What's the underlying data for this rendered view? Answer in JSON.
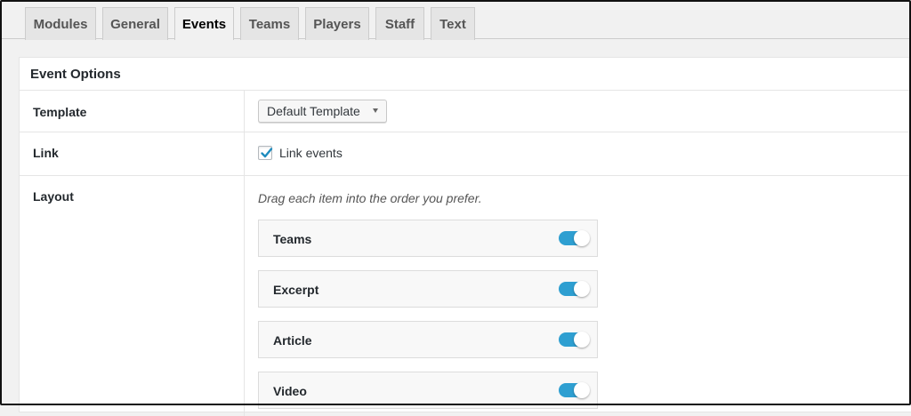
{
  "tabs": [
    {
      "label": "Modules",
      "active": false
    },
    {
      "label": "General",
      "active": false
    },
    {
      "label": "Events",
      "active": true
    },
    {
      "label": "Teams",
      "active": false
    },
    {
      "label": "Players",
      "active": false
    },
    {
      "label": "Staff",
      "active": false
    },
    {
      "label": "Text",
      "active": false
    }
  ],
  "panel": {
    "title": "Event Options",
    "template": {
      "label": "Template",
      "selected": "Default Template"
    },
    "link": {
      "label": "Link",
      "checkbox_label": "Link events",
      "checked": true
    },
    "layout": {
      "label": "Layout",
      "hint": "Drag each item into the order you prefer.",
      "items": [
        {
          "label": "Teams",
          "enabled": true
        },
        {
          "label": "Excerpt",
          "enabled": true
        },
        {
          "label": "Article",
          "enabled": true
        },
        {
          "label": "Video",
          "enabled": true
        }
      ]
    }
  },
  "colors": {
    "toggle_on": "#2e9fd1",
    "check": "#1e8cbe"
  }
}
